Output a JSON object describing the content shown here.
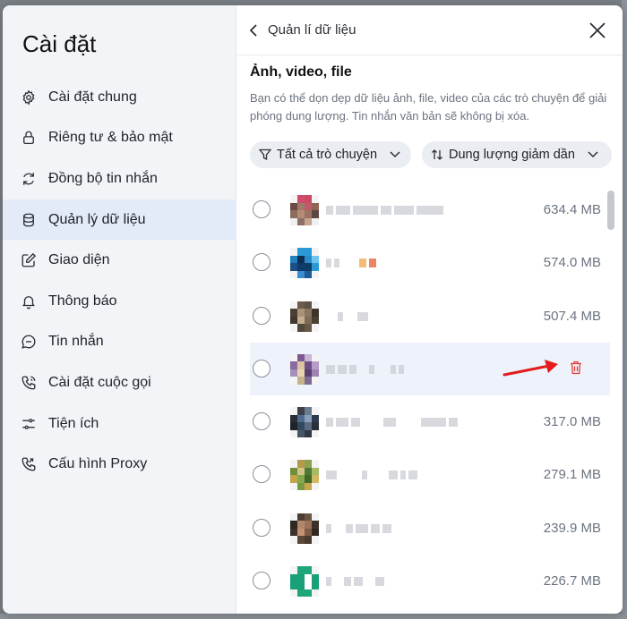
{
  "sidebar": {
    "title": "Cài đặt",
    "items": [
      {
        "label": "Cài đặt chung",
        "icon": "gear-icon"
      },
      {
        "label": "Riêng tư & bảo mật",
        "icon": "lock-icon"
      },
      {
        "label": "Đồng bộ tin nhắn",
        "icon": "sync-icon"
      },
      {
        "label": "Quản lý dữ liệu",
        "icon": "database-icon",
        "active": true
      },
      {
        "label": "Giao diện",
        "icon": "edit-icon"
      },
      {
        "label": "Thông báo",
        "icon": "bell-icon"
      },
      {
        "label": "Tin nhắn",
        "icon": "chat-icon"
      },
      {
        "label": "Cài đặt cuộc gọi",
        "icon": "phone-icon"
      },
      {
        "label": "Tiện ích",
        "icon": "sliders-icon"
      },
      {
        "label": "Cấu hình Proxy",
        "icon": "proxy-icon"
      }
    ]
  },
  "header": {
    "title": "Quản lí dữ liệu"
  },
  "section": {
    "title": "Ảnh, video, file",
    "description": "Bạn có thể dọn dẹp dữ liệu ảnh, file, video của các trò chuyện để giải phóng dung lượng. Tin nhắn văn bản sẽ không bị xóa."
  },
  "filters": {
    "conversations": "Tất cả trò chuyện",
    "sort": "Dung lượng giảm dần"
  },
  "conversations": [
    {
      "size": "634.4 MB"
    },
    {
      "size": "574.0 MB"
    },
    {
      "size": "507.4 MB"
    },
    {
      "size": "",
      "hovered": true
    },
    {
      "size": "317.0 MB"
    },
    {
      "size": "279.1 MB"
    },
    {
      "size": "239.9 MB"
    },
    {
      "size": "226.7 MB"
    }
  ],
  "colors": {
    "accent_active": "#e3ebf8",
    "delete": "#e53935",
    "annotation_arrow": "#e31b1b"
  }
}
